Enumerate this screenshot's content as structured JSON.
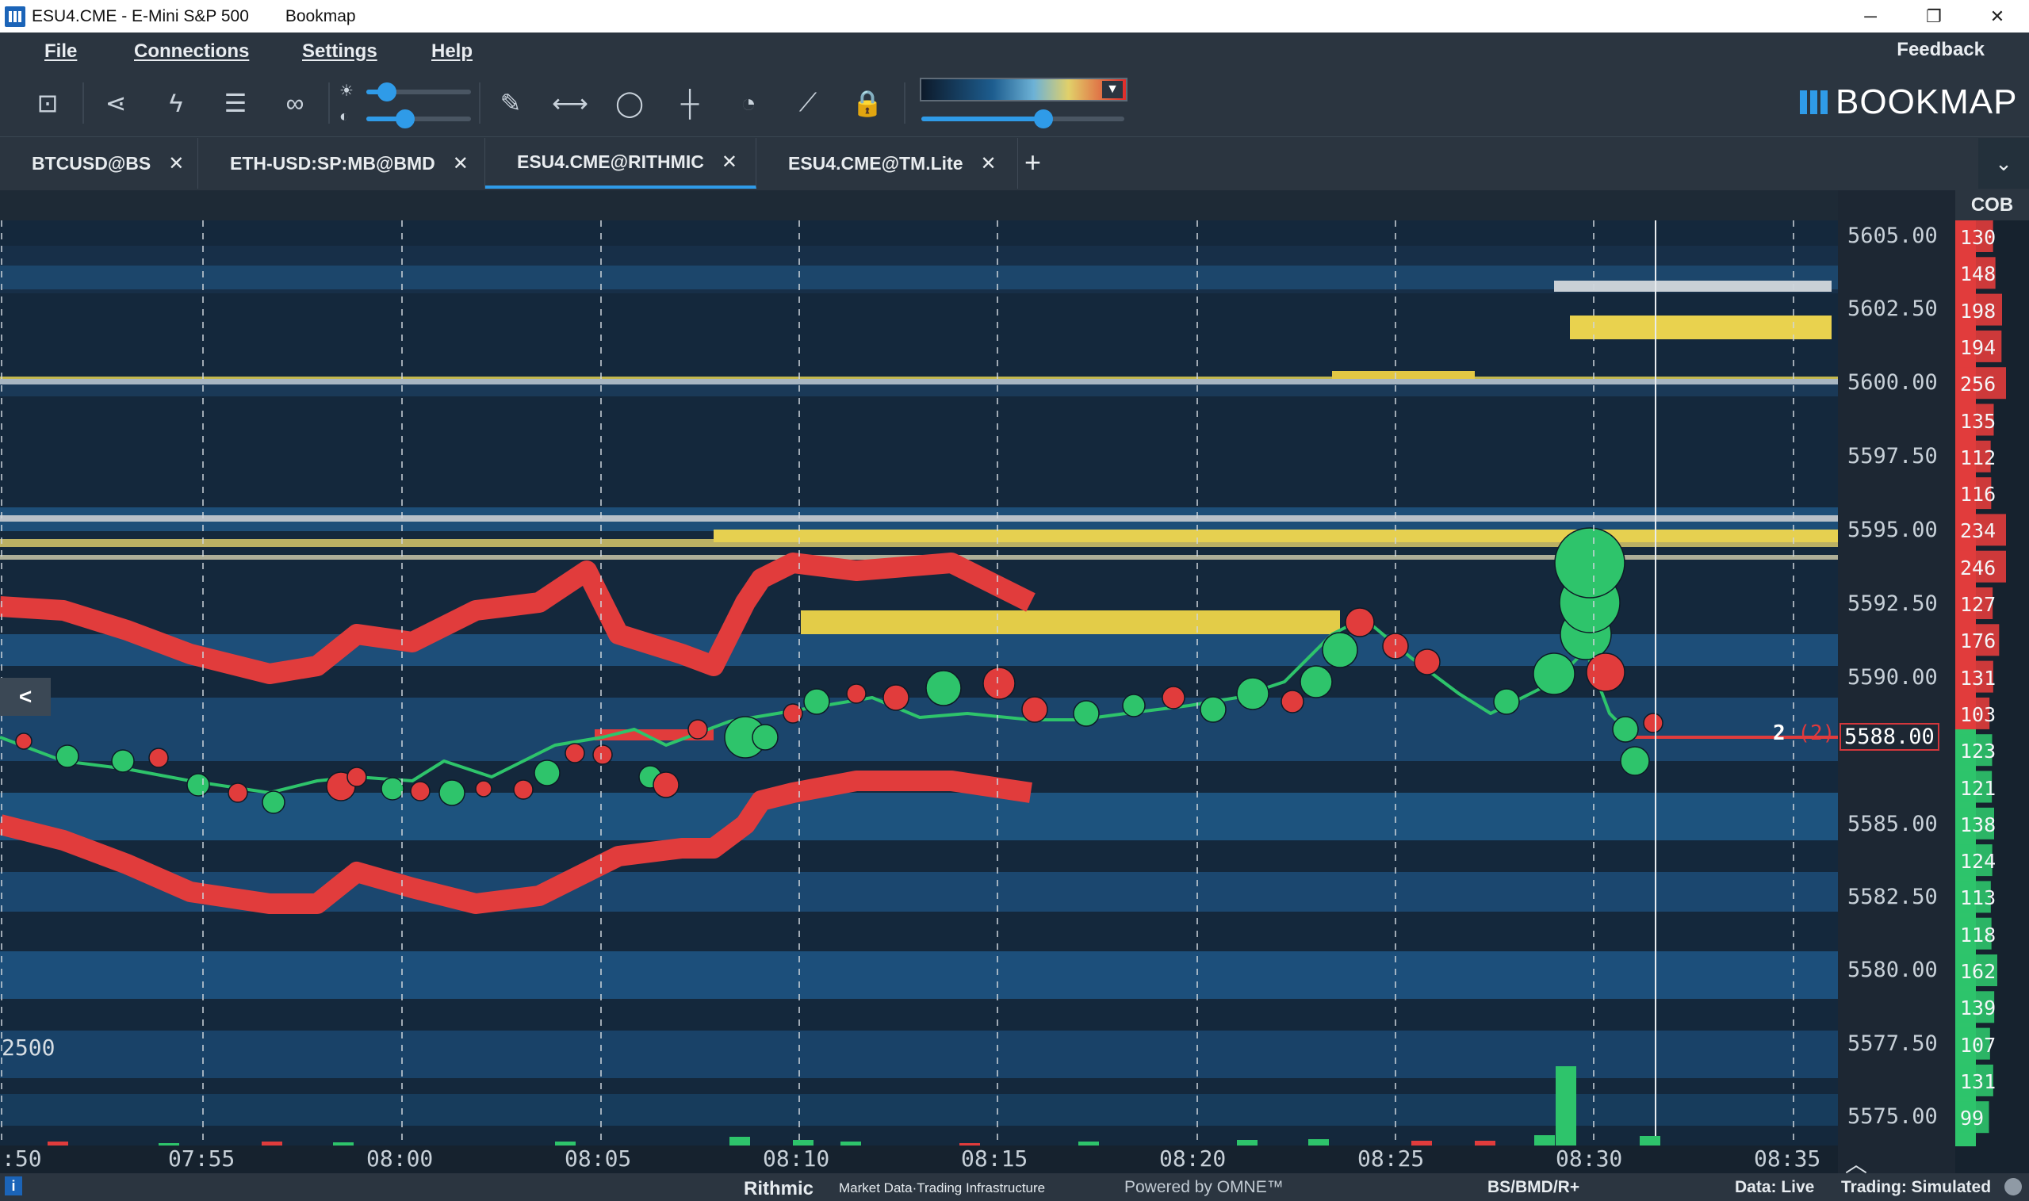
{
  "window": {
    "title": "ESU4.CME - E-Mini S&P 500",
    "app": "Bookmap",
    "controls": [
      "─",
      "❐",
      "✕"
    ]
  },
  "menu": {
    "items": [
      "File",
      "Connections",
      "Settings",
      "Help"
    ],
    "feedback": "Feedback"
  },
  "toolbar": {
    "icons": [
      "screenshot-icon",
      "share-icon",
      "lightning-icon",
      "layers-icon",
      "link-icon",
      "pencil-icon",
      "ruler-icon",
      "chat-icon",
      "crosshair-icon",
      "stopwatch-icon",
      "chart-icon",
      "lock-icon"
    ],
    "brightness_slider": 0.2,
    "contrast_slider": 0.37,
    "color_slider": 0.6,
    "logo": "BOOKMAP"
  },
  "tabs": [
    {
      "label": "BTCUSD@BS",
      "close": "✕",
      "active": false
    },
    {
      "label": "ETH-USD:SP:MB@BMD",
      "close": "✕",
      "active": false
    },
    {
      "label": "ESU4.CME@RITHMIC",
      "close": "✕",
      "active": true
    },
    {
      "label": "ESU4.CME@TM.Lite",
      "close": "✕",
      "active": false
    }
  ],
  "tab_add": "+",
  "tab_menu": "⌄",
  "chart": {
    "collapse": "<",
    "volume_max": "2500",
    "current_price": "5588.00",
    "quantity": "2",
    "quantity_paren": "(2)",
    "up_arrow": "︿",
    "prices": [
      "5605.00",
      "5602.50",
      "5600.00",
      "5597.50",
      "5595.00",
      "5592.50",
      "5590.00",
      "5588.00",
      "5585.00",
      "5582.50",
      "5580.00",
      "5577.50",
      "5575.00"
    ],
    "times": [
      ":50",
      "07:55",
      "08:00",
      "08:05",
      "08:10",
      "08:15",
      "08:20",
      "08:25",
      "08:30",
      "08:35"
    ],
    "cob_header": "COB",
    "cob_asks": [
      "130",
      "148",
      "198",
      "194",
      "256",
      "135",
      "112",
      "116",
      "234",
      "246",
      "127",
      "176",
      "131",
      "103"
    ],
    "cob_bids": [
      "123",
      "121",
      "138",
      "124",
      "113",
      "118",
      "162",
      "139",
      "107",
      "131",
      "99"
    ],
    "colors": {
      "bid": "#e13c3c",
      "ask": "#2ec46b",
      "heat_low": "#163a5c",
      "heat_high": "#e8d24a"
    }
  },
  "status": {
    "rithmic": "Rithmic",
    "rithmic_tag": "Market Data·Trading Infrastructure",
    "omne": "Powered by OMNE™",
    "feeds": "BS/BMD/R+",
    "data": "Data: Live",
    "trading": "Trading: Simulated"
  }
}
